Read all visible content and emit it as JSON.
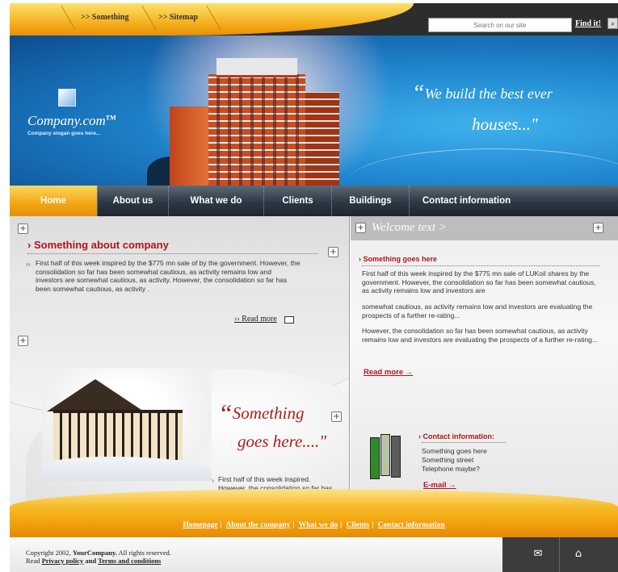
{
  "topnav": {
    "links": [
      ">> Something",
      ">> Sitemap"
    ],
    "search_placeholder": "Search on our site",
    "find_label": "Find it!"
  },
  "hero": {
    "logo_name": "Company.com",
    "logo_tm": "TM",
    "logo_slogan": "Company slogan goes here...",
    "quote_line1": "We build the best ever",
    "quote_line2": "houses...\""
  },
  "nav": {
    "items": [
      "Home",
      "About us",
      "What we do",
      "Clients",
      "Buildings",
      "Contact information"
    ],
    "active": "Home"
  },
  "about": {
    "heading": "Something about company",
    "bullet": "››",
    "body": "First half of this week inspired by the $775 mn sale of by the government. However, the consolidation so far has been somewhat cautious, as activity remains low and investors are somewhat cautious, as activity. However, the consolidation so far has been somewhat cautious, as activity .",
    "read_more": "Read more"
  },
  "promo": {
    "quote_line1": "Something",
    "quote_line2": "goes here....\"",
    "body": "First half of this week inspired. However, the consolidation so far has been."
  },
  "welcome": {
    "title": "Welcome text >",
    "subheading": "Something goes here",
    "paragraph1": "First half of this week inspired by the $775 mn sale of LUKoil shares by the government. However, the consolidation so far has been somewhat cautious, as activity remains low and investors are",
    "paragraph2": "somewhat cautious, as activity remains low and investors are evaluating the prospects of a further re-rating...",
    "paragraph3": "However, the consolidation so far has been somewhat cautious, as activity remains low and investors are evaluating the prospects of a further re-rating...",
    "read_more": "Read more"
  },
  "contact": {
    "heading": "Contact information:",
    "line1": "Something goes here",
    "line2": "Something street",
    "line3": "Telephone maybe?",
    "email_label": "E-mail"
  },
  "footer": {
    "links": [
      "Homepage",
      "About the company",
      "What we do",
      "Clients",
      "Contact information"
    ],
    "separator": "|",
    "copyright_prefix": "Copyright 2002,",
    "company": "YourCompany.",
    "rights": "All rights reserved.",
    "read": "Read",
    "privacy": "Privacy policy",
    "and": "and",
    "terms": "Terms and conditions"
  },
  "colors": {
    "accent_orange": "#f3a514",
    "accent_red": "#b0151b",
    "hero_blue": "#1f86cf",
    "nav_dark": "#2c3843"
  },
  "icons": [
    "search-icon",
    "expand-icon",
    "mail-icon",
    "home-icon",
    "arrow-right-icon"
  ]
}
